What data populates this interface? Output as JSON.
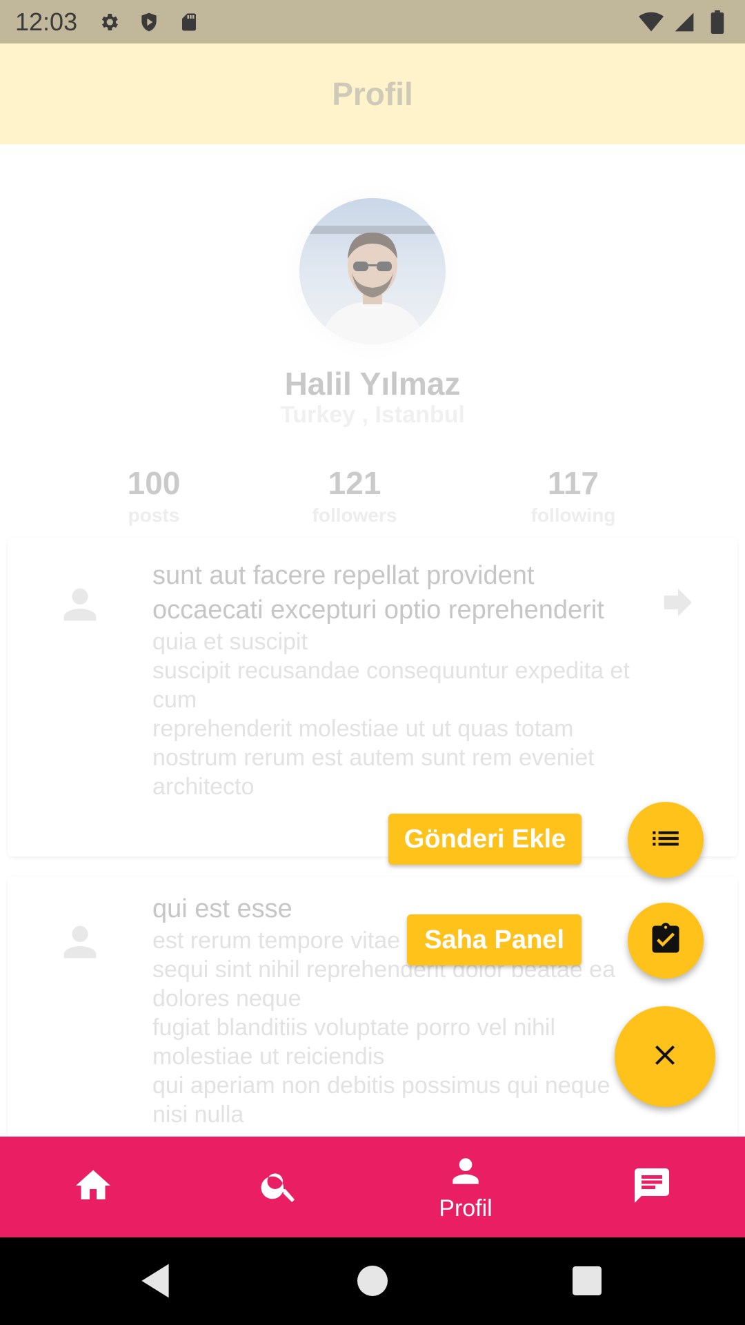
{
  "status_bar": {
    "time": "12:03",
    "icons_left": [
      "settings-icon",
      "shield-icon",
      "sd-card-icon"
    ],
    "icons_right": [
      "wifi-icon",
      "signal-icon",
      "battery-icon"
    ]
  },
  "app_bar": {
    "title": "Profil"
  },
  "profile": {
    "name": "Halil Yılmaz",
    "location": "Turkey , Istanbul",
    "stats": [
      {
        "value": "100",
        "label": "posts"
      },
      {
        "value": "121",
        "label": "followers"
      },
      {
        "value": "117",
        "label": "following"
      }
    ]
  },
  "posts": [
    {
      "title": "sunt aut facere repellat provident occaecati excepturi optio reprehenderit",
      "body": "quia et suscipit\nsuscipit recusandae consequuntur expedita et cum\nreprehenderit molestiae ut ut quas totam\nnostrum rerum est autem sunt rem eveniet architecto"
    },
    {
      "title": "qui est esse",
      "body": "est rerum tempore vitae\nsequi sint nihil reprehenderit dolor beatae ea dolores neque\nfugiat blanditiis voluptate porro vel nihil molestiae ut reiciendis\nqui aperiam non debitis possimus qui neque nisi nulla"
    }
  ],
  "speed_dial": {
    "actions": [
      {
        "label": "Gönderi Ekle",
        "icon": "list-icon"
      },
      {
        "label": "Saha Panel",
        "icon": "clipboard-check-icon"
      }
    ],
    "main_icon": "close-icon"
  },
  "bottom_nav": {
    "items": [
      {
        "icon": "home-icon",
        "label": ""
      },
      {
        "icon": "search-icon",
        "label": ""
      },
      {
        "icon": "person-icon",
        "label": "Profil"
      },
      {
        "icon": "chat-icon",
        "label": ""
      }
    ],
    "active_index": 2
  },
  "colors": {
    "status_bar": "#c1b79a",
    "app_bar": "#fff3cc",
    "accent_fab": "#ffc21a",
    "bottom_nav": "#ea1e63"
  }
}
